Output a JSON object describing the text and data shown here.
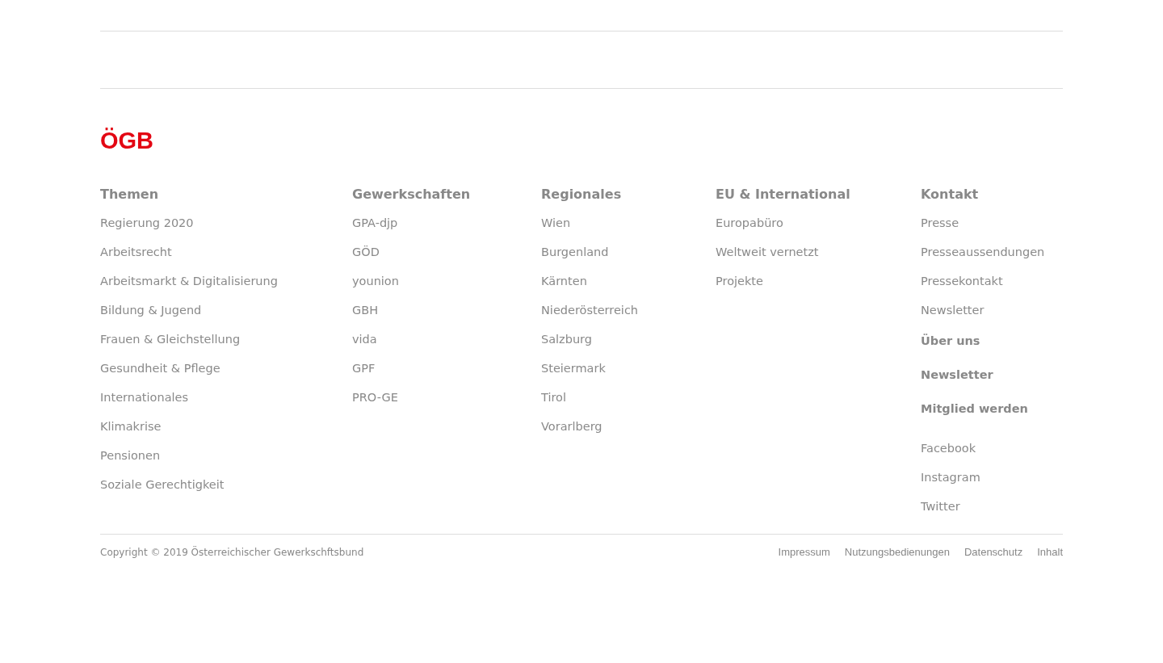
{
  "logo": "ÖGB",
  "columns": [
    {
      "heading": "Themen",
      "links": [
        "Regierung 2020",
        "Arbeitsrecht",
        "Arbeitsmarkt & Digitalisierung",
        "Bildung & Jugend",
        "Frauen & Gleichstellung",
        "Gesundheit & Pflege",
        "Internationales",
        "Klimakrise",
        "Pensionen",
        "Soziale Gerechtigkeit"
      ]
    },
    {
      "heading": "Gewerkschaften",
      "links": [
        "GPA-djp",
        "GÖD",
        "younion",
        "GBH",
        "vida",
        "GPF",
        "PRO-GE"
      ]
    },
    {
      "heading": "Regionales",
      "links": [
        "Wien",
        "Burgenland",
        "Kärnten",
        "Niederösterreich",
        "Salzburg",
        "Steiermark",
        "Tirol",
        "Vorarlberg"
      ]
    },
    {
      "heading": "EU & International",
      "links": [
        "Europabüro",
        "Weltweit vernetzt",
        "Projekte"
      ]
    },
    {
      "heading": "Kontakt",
      "links": [
        "Presse",
        "Presseaussendungen",
        "Pressekontakt",
        "Newsletter"
      ],
      "bold_links": [
        "Über uns",
        "Newsletter",
        "Mitglied werden"
      ],
      "social_links": [
        "Facebook",
        "Instagram",
        "Twitter"
      ]
    }
  ],
  "copyright": "Copyright © 2019 Österreichischer Gewerkschftsbund",
  "legal_links": [
    "Impressum",
    "Nutzungsbedienungen",
    "Datenschutz",
    "Inhalt"
  ]
}
